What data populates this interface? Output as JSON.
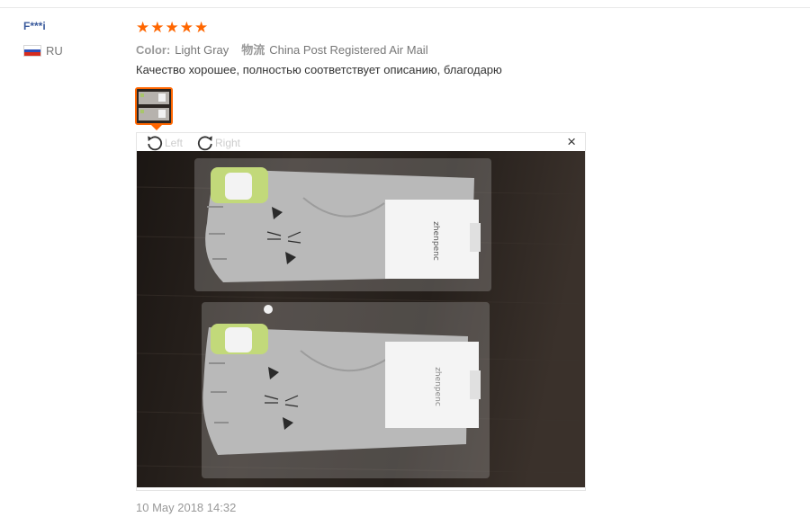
{
  "review": {
    "user_name": "F***i",
    "country_code": "RU",
    "rating": 5,
    "attributes": [
      {
        "label": "Color:",
        "value": "Light Gray"
      },
      {
        "label": "物流",
        "value": "China Post Registered Air Mail"
      }
    ],
    "text": "Качество хорошее, полностью соответствует описанию, благодарю",
    "date": "10 May 2018 14:32"
  },
  "viewer": {
    "rotate_left_label": "Left",
    "rotate_right_label": "Right",
    "close_glyph": "×"
  },
  "colors": {
    "star": "#ff6600",
    "thumb_border": "#ff6600",
    "user_name": "#3a5a9c",
    "flag": [
      "#ffffff",
      "#2c4fb8",
      "#d52b1e"
    ]
  },
  "icons": {
    "rating": "star-icon",
    "rotate_left": "rotate-left-icon",
    "rotate_right": "rotate-right-icon",
    "close": "close-icon"
  }
}
